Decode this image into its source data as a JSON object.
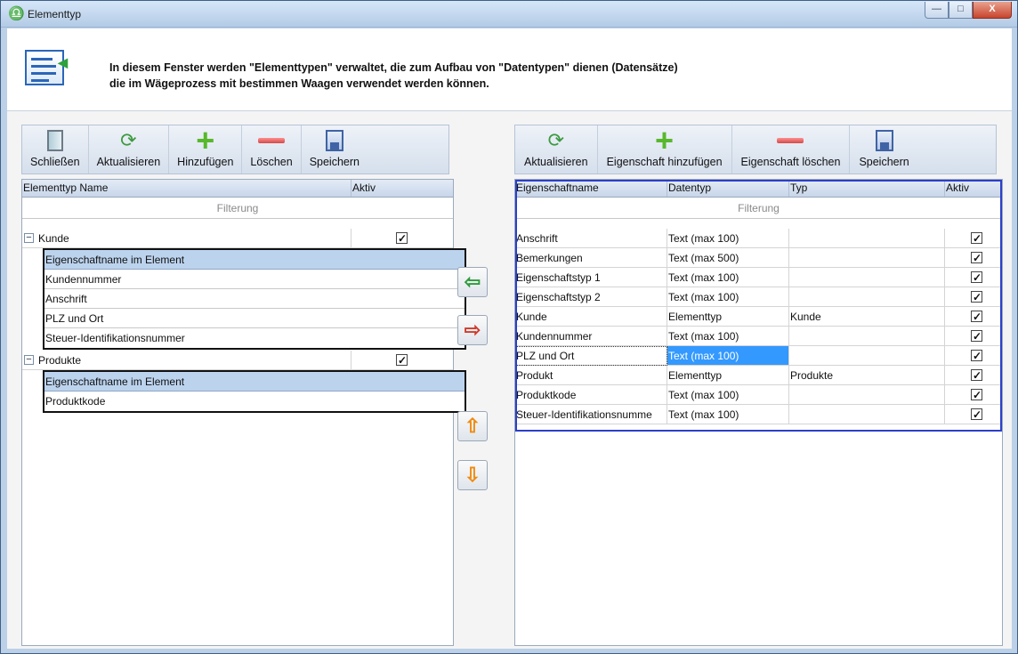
{
  "window": {
    "title": "Elementtyp",
    "buttons": {
      "minimize": "—",
      "maximize": "□",
      "close": "X"
    }
  },
  "header": {
    "line1": "In diesem Fenster werden \"Elementtypen\" verwaltet, die zum Aufbau von \"Datentypen\" dienen (Datensätze)",
    "line2": "die im Wägeprozess mit bestimmen Waagen verwendet werden können."
  },
  "left": {
    "toolbar": {
      "close": "Schließen",
      "refresh": "Aktualisieren",
      "add": "Hinzufügen",
      "delete": "Löschen",
      "save": "Speichern"
    },
    "columns": {
      "name": "Elementtyp Name",
      "active": "Aktiv"
    },
    "filter": "Filterung",
    "groups": [
      {
        "name": "Kunde",
        "active": true,
        "sub_header": "Eigenschaftname im Element",
        "items": [
          "Kundennummer",
          "Anschrift",
          "PLZ und Ort",
          "Steuer-Identifikationsnummer"
        ]
      },
      {
        "name": "Produkte",
        "active": true,
        "sub_header": "Eigenschaftname im Element",
        "items": [
          "Produktkode"
        ]
      }
    ]
  },
  "middle": {
    "move_left": "⇦",
    "move_right": "⇨",
    "move_up": "⇧",
    "move_down": "⇩"
  },
  "right": {
    "toolbar": {
      "refresh": "Aktualisieren",
      "add": "Eigenschaft hinzufügen",
      "delete": "Eigenschaft löschen",
      "save": "Speichern"
    },
    "columns": {
      "name": "Eigenschaftname",
      "datatype": "Datentyp",
      "type": "Typ",
      "active": "Aktiv"
    },
    "filter": "Filterung",
    "rows": [
      {
        "name": "Anschrift",
        "datatype": "Text (max 100)",
        "type": "",
        "active": true
      },
      {
        "name": "Bemerkungen",
        "datatype": "Text (max 500)",
        "type": "",
        "active": true
      },
      {
        "name": "Eigenschaftstyp 1",
        "datatype": "Text (max 100)",
        "type": "",
        "active": true
      },
      {
        "name": "Eigenschaftstyp 2",
        "datatype": "Text (max 100)",
        "type": "",
        "active": true
      },
      {
        "name": "Kunde",
        "datatype": "Elementtyp",
        "type": "Kunde",
        "active": true
      },
      {
        "name": "Kundennummer",
        "datatype": "Text (max 100)",
        "type": "",
        "active": true
      },
      {
        "name": "PLZ und Ort",
        "datatype": "Text (max 100)",
        "type": "",
        "active": true
      },
      {
        "name": "Produkt",
        "datatype": "Elementtyp",
        "type": "Produkte",
        "active": true
      },
      {
        "name": "Produktkode",
        "datatype": "Text (max 100)",
        "type": "",
        "active": true
      },
      {
        "name": "Steuer-Identifikationsnumme",
        "datatype": "Text (max 100)",
        "type": "",
        "active": true
      }
    ],
    "selected_index": 6
  }
}
